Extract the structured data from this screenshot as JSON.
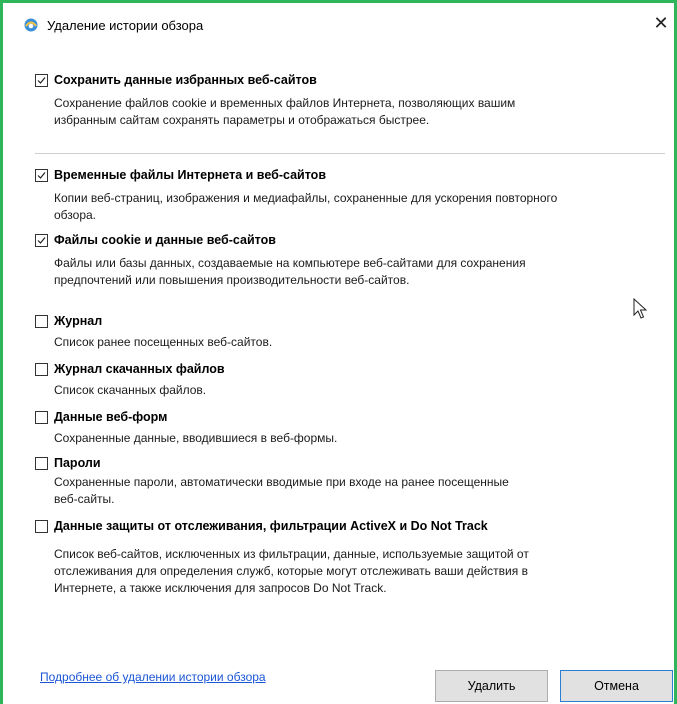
{
  "window": {
    "title": "Удаление истории обзора",
    "close_glyph": "✕"
  },
  "options": [
    {
      "title": "Сохранить данные избранных веб-сайтов",
      "checked": true,
      "desc_lines": [
        "Сохранение файлов cookie и временных файлов Интернета, позволяющих вашим",
        "избранным сайтам сохранять параметры и отображаться быстрее."
      ]
    },
    {
      "title": "Временные файлы Интернета и веб-сайтов",
      "checked": true,
      "desc_lines": [
        "Копии веб-страниц, изображения и медиафайлы, сохраненные для ускорения повторного",
        "обзора."
      ]
    },
    {
      "title": "Файлы cookie и данные веб-сайтов",
      "checked": true,
      "desc_lines": [
        "Файлы или базы данных, создаваемые на компьютере веб-сайтами для сохранения",
        "предпочтений или повышения производительности веб-сайтов."
      ]
    },
    {
      "title": "Журнал",
      "checked": false,
      "desc_lines": [
        "Список ранее посещенных веб-сайтов."
      ]
    },
    {
      "title": "Журнал скачанных файлов",
      "checked": false,
      "desc_lines": [
        "Список скачанных файлов."
      ]
    },
    {
      "title": "Данные веб-форм",
      "checked": false,
      "desc_lines": [
        "Сохраненные данные, вводившиеся в веб-формы."
      ]
    },
    {
      "title": "Пароли",
      "checked": false,
      "desc_lines": [
        "Сохраненные пароли, автоматически вводимые при входе на ранее посещенные",
        "веб-сайты."
      ]
    },
    {
      "title": "Данные защиты от отслеживания, фильтрации ActiveX и Do Not Track",
      "checked": false,
      "desc_lines": [
        "Список веб-сайтов, исключенных из фильтрации, данные, используемые защитой от",
        "отслеживания для определения служб, которые могут отслеживать ваши действия в",
        "Интернете, а также исключения для запросов Do Not Track."
      ]
    }
  ],
  "footer": {
    "link_text": "Подробнее об удалении истории обзора",
    "delete_label": "Удалить",
    "cancel_label": "Отмена"
  },
  "colors": {
    "window_border": "#2fb65a",
    "link": "#1a56d6",
    "focus_border": "#2a7fd4"
  }
}
